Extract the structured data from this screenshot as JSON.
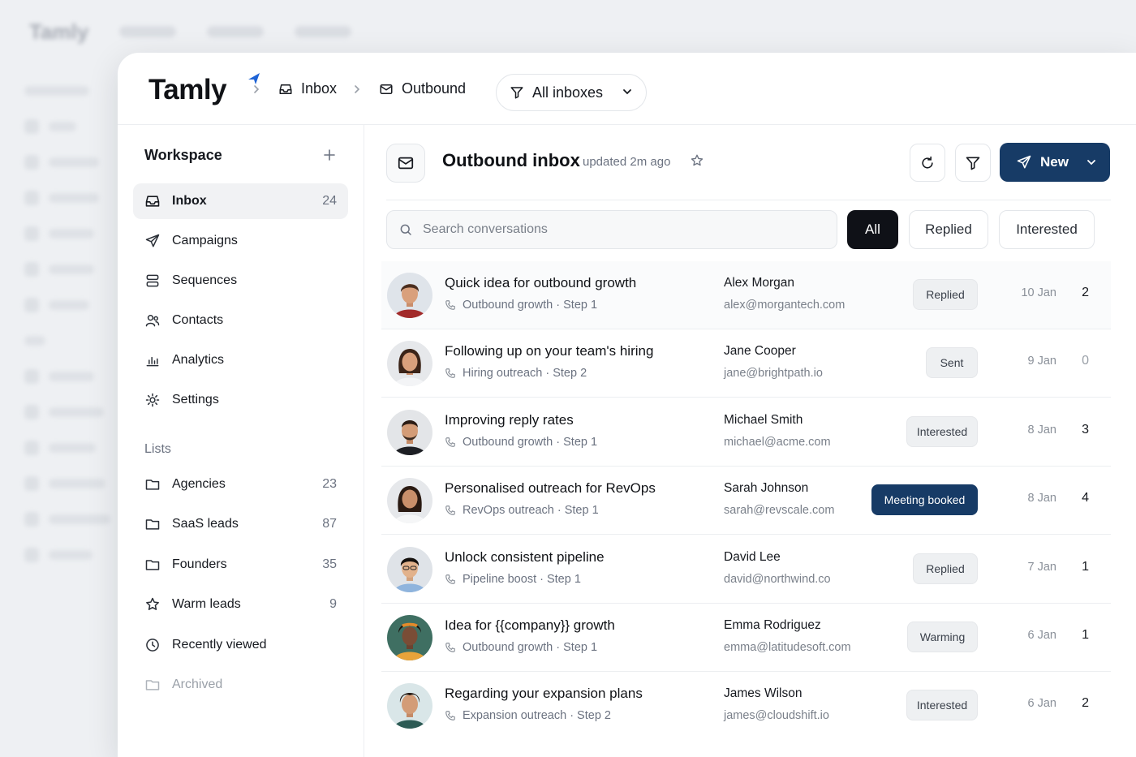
{
  "background": {
    "logo": "Tamly"
  },
  "app": {
    "logo": "Tamly",
    "breadcrumb": [
      {
        "label": "Inbox",
        "icon": "inbox-icon"
      },
      {
        "label": "Outbound",
        "icon": "mail-icon"
      }
    ],
    "inbox_filter": {
      "label": "All inboxes",
      "icon": "filter-icon"
    }
  },
  "sidebar": {
    "workspace_title": "Workspace",
    "items": [
      {
        "label": "Inbox",
        "count": "24",
        "icon": "inbox-icon",
        "active": true
      },
      {
        "label": "Campaigns",
        "count": "",
        "icon": "send-icon"
      },
      {
        "label": "Sequences",
        "count": "",
        "icon": "sequences-icon"
      },
      {
        "label": "Contacts",
        "count": "",
        "icon": "users-icon"
      },
      {
        "label": "Analytics",
        "count": "",
        "icon": "analytics-icon"
      },
      {
        "label": "Settings",
        "count": "",
        "icon": "gear-icon"
      }
    ],
    "lists_title": "Lists",
    "lists": [
      {
        "label": "Agencies",
        "count": "23",
        "icon": "folder-icon"
      },
      {
        "label": "SaaS leads",
        "count": "87",
        "icon": "folder-icon"
      },
      {
        "label": "Founders",
        "count": "35",
        "icon": "folder-icon"
      },
      {
        "label": "Warm leads",
        "count": "9",
        "icon": "star-icon"
      },
      {
        "label": "Recently viewed",
        "count": "",
        "icon": "clock-icon"
      },
      {
        "label": "Archived",
        "count": "",
        "icon": "folder-icon"
      }
    ]
  },
  "main": {
    "title": "Outbound inbox",
    "updated": "updated 2m ago",
    "new_button": "New",
    "search_placeholder": "Search conversations",
    "tabs": [
      {
        "label": "All",
        "active": true
      },
      {
        "label": "Replied"
      },
      {
        "label": "Interested"
      }
    ],
    "conversations": [
      {
        "subject": "Quick idea for outbound growth",
        "sequence": "Outbound growth · Step 1",
        "name": "Alex Morgan",
        "email": "alex@morgantech.com",
        "status": "Replied",
        "date": "10 Jan",
        "count": "2"
      },
      {
        "subject": "Following up on your team's hiring",
        "sequence": "Hiring outreach · Step 2",
        "name": "Jane Cooper",
        "email": "jane@brightpath.io",
        "status": "Sent",
        "date": "9 Jan",
        "count": "0"
      },
      {
        "subject": "Improving reply rates",
        "sequence": "Outbound growth · Step 1",
        "name": "Michael Smith",
        "email": "michael@acme.com",
        "status": "Interested",
        "date": "8 Jan",
        "count": "3"
      },
      {
        "subject": "Personalised outreach for RevOps",
        "sequence": "RevOps outreach · Step 1",
        "name": "Sarah Johnson",
        "email": "sarah@revscale.com",
        "status": "Meeting booked",
        "date": "8 Jan",
        "count": "4"
      },
      {
        "subject": "Unlock consistent pipeline",
        "sequence": "Pipeline boost · Step 1",
        "name": "David Lee",
        "email": "david@northwind.co",
        "status": "Replied",
        "date": "7 Jan",
        "count": "1"
      },
      {
        "subject": "Idea for {{company}} growth",
        "sequence": "Outbound growth · Step 1",
        "name": "Emma Rodriguez",
        "email": "emma@latitudesoft.com",
        "status": "Warming",
        "date": "6 Jan",
        "count": "1"
      },
      {
        "subject": "Regarding your expansion plans",
        "sequence": "Expansion outreach · Step 2",
        "name": "James Wilson",
        "email": "james@cloudshift.io",
        "status": "Interested",
        "date": "6 Jan",
        "count": "2"
      }
    ]
  },
  "colors": {
    "primary": "#173b66",
    "active_tab": "#0f1117",
    "accent_logo": "#1e63d6"
  }
}
